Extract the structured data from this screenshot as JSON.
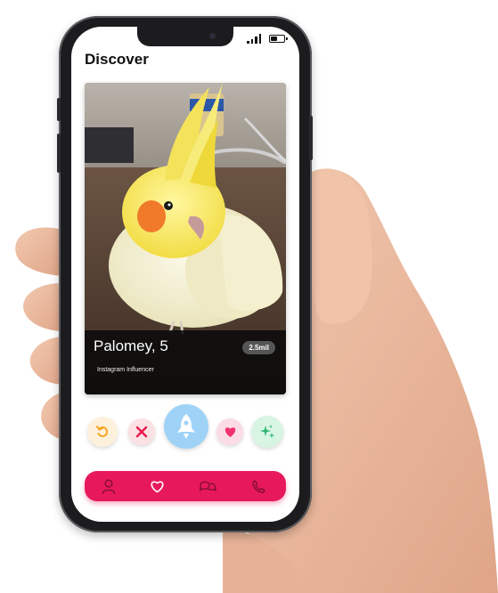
{
  "screen": {
    "title": "Discover"
  },
  "status_bar": {
    "icons": [
      "signal-icon",
      "battery-icon"
    ],
    "battery_level": 0.5
  },
  "profile": {
    "name_age": "Palomey, 5",
    "distance": "2.5mil",
    "bio": "Instagram Influencer",
    "photo_subject": "cockatiel"
  },
  "actions": [
    {
      "name": "undo",
      "icon": "undo-icon",
      "color": "#f5a623",
      "bg": "#fdf1dc"
    },
    {
      "name": "dislike",
      "icon": "close-icon",
      "color": "#e8194b",
      "bg": "#fbe0e4"
    },
    {
      "name": "boost",
      "icon": "rocket-icon",
      "color": "#ffffff",
      "bg": "#9ed3f7"
    },
    {
      "name": "like",
      "icon": "heart-icon",
      "color": "#f0326e",
      "bg": "#fbdce6"
    },
    {
      "name": "super-like",
      "icon": "sparkle-icon",
      "color": "#2bb673",
      "bg": "#d8f4e3"
    }
  ],
  "nav": {
    "color": "#e8195b",
    "items": [
      "profile-icon",
      "heart-icon",
      "chat-icon",
      "phone-icon"
    ]
  }
}
